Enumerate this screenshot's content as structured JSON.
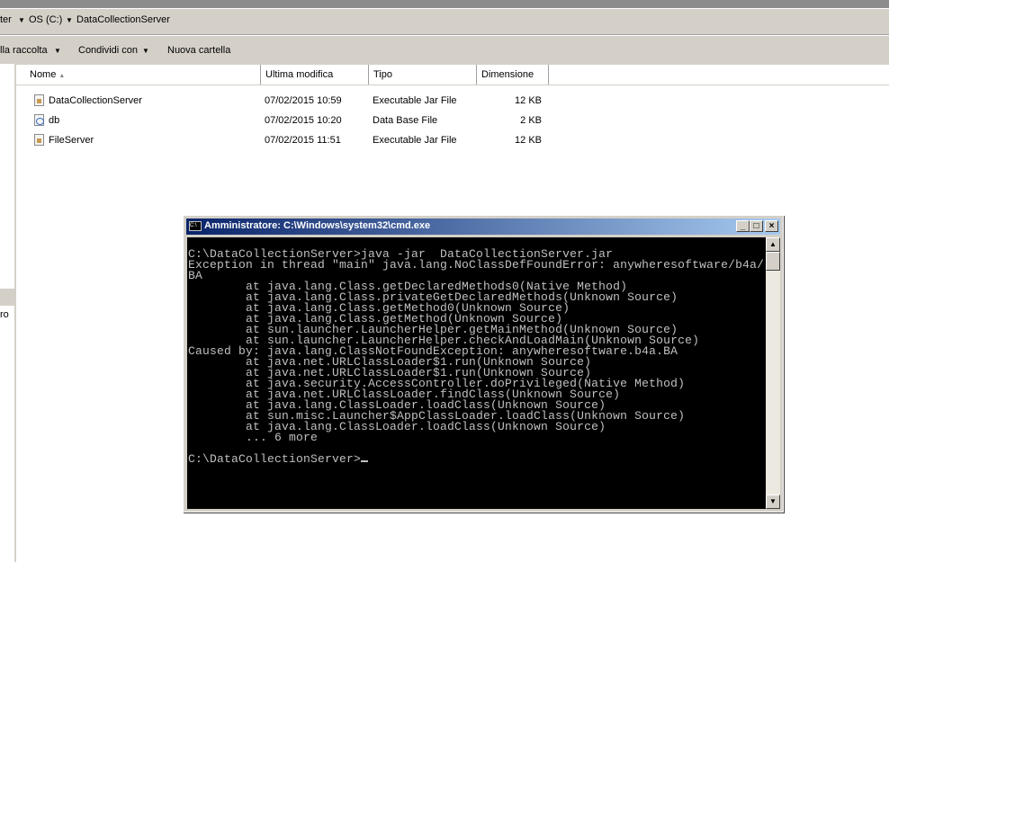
{
  "explorer": {
    "breadcrumb": [
      "ter",
      "OS (C:)",
      "DataCollectionServer"
    ],
    "toolbar": [
      "lla raccolta",
      "Condividi con",
      "Nuova cartella"
    ],
    "sidebar_text": "ro",
    "columns": [
      "Nome",
      "Ultima modifica",
      "Tipo",
      "Dimensione"
    ],
    "files": [
      {
        "name": "DataCollectionServer",
        "modified": "07/02/2015 10:59",
        "type": "Executable Jar File",
        "size": "12 KB",
        "icon": "jar-file-icon"
      },
      {
        "name": "db",
        "modified": "07/02/2015 10:20",
        "type": "Data Base File",
        "size": "2 KB",
        "icon": "db-file-icon"
      },
      {
        "name": "FileServer",
        "modified": "07/02/2015 11:51",
        "type": "Executable Jar File",
        "size": "12 KB",
        "icon": "jar-file-icon"
      }
    ]
  },
  "cmd": {
    "title": "Amministratore: C:\\Windows\\system32\\cmd.exe",
    "lines": [
      "C:\\DataCollectionServer>java -jar  DataCollectionServer.jar",
      "Exception in thread \"main\" java.lang.NoClassDefFoundError: anywheresoftware/b4a/",
      "BA",
      "        at java.lang.Class.getDeclaredMethods0(Native Method)",
      "        at java.lang.Class.privateGetDeclaredMethods(Unknown Source)",
      "        at java.lang.Class.getMethod0(Unknown Source)",
      "        at java.lang.Class.getMethod(Unknown Source)",
      "        at sun.launcher.LauncherHelper.getMainMethod(Unknown Source)",
      "        at sun.launcher.LauncherHelper.checkAndLoadMain(Unknown Source)",
      "Caused by: java.lang.ClassNotFoundException: anywheresoftware.b4a.BA",
      "        at java.net.URLClassLoader$1.run(Unknown Source)",
      "        at java.net.URLClassLoader$1.run(Unknown Source)",
      "        at java.security.AccessController.doPrivileged(Native Method)",
      "        at java.net.URLClassLoader.findClass(Unknown Source)",
      "        at java.lang.ClassLoader.loadClass(Unknown Source)",
      "        at sun.misc.Launcher$AppClassLoader.loadClass(Unknown Source)",
      "        at java.lang.ClassLoader.loadClass(Unknown Source)",
      "        ... 6 more",
      "",
      "C:\\DataCollectionServer>"
    ]
  }
}
